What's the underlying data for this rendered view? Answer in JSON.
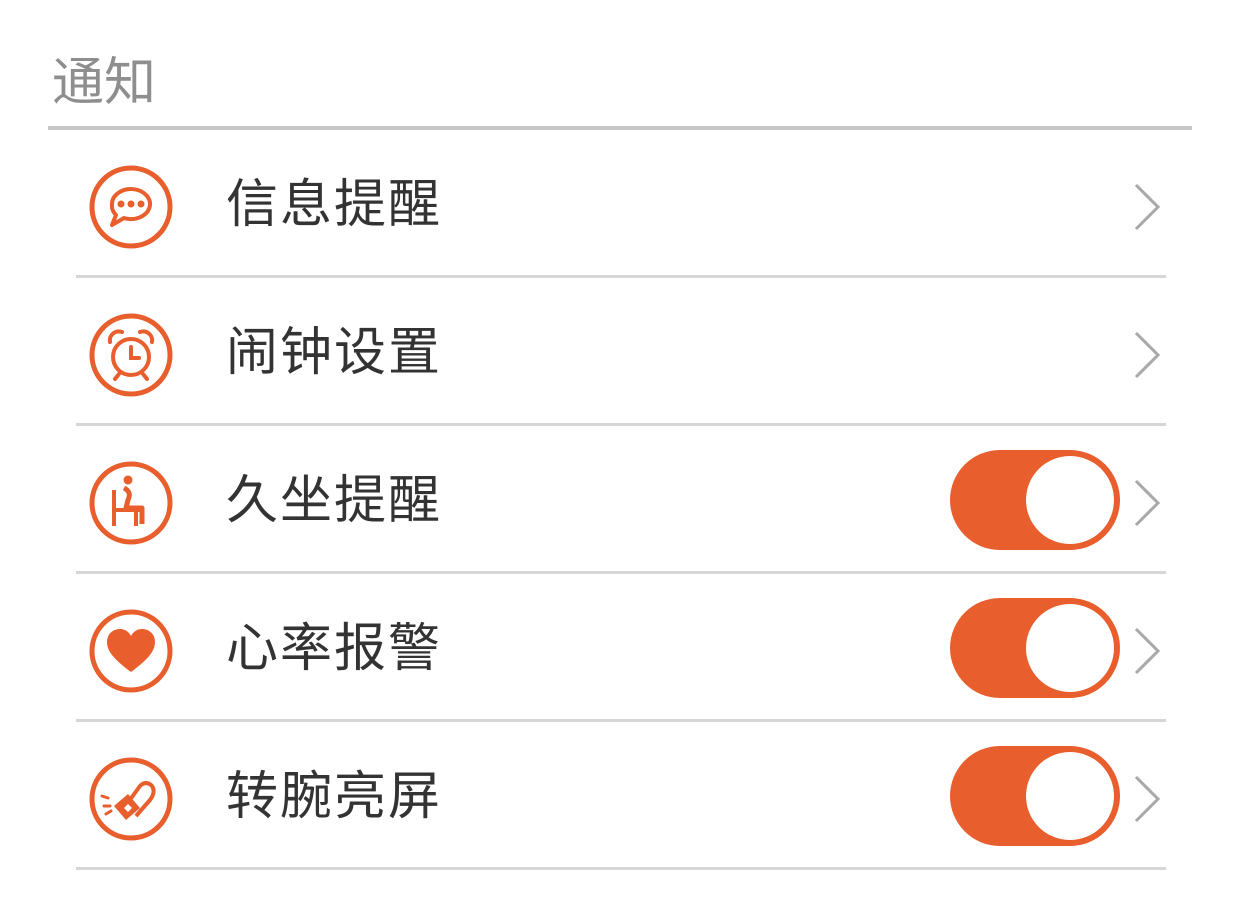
{
  "section": {
    "title": "通知"
  },
  "colors": {
    "accent": "#e85e2c",
    "divider": "#d6d6d6",
    "header_text": "#8e8e8e",
    "label_text": "#333333"
  },
  "items": [
    {
      "label": "信息提醒",
      "icon": "chat-bubble-icon",
      "has_toggle": false,
      "toggle_on": null
    },
    {
      "label": "闹钟设置",
      "icon": "alarm-clock-icon",
      "has_toggle": false,
      "toggle_on": null
    },
    {
      "label": "久坐提醒",
      "icon": "sitting-person-icon",
      "has_toggle": true,
      "toggle_on": true
    },
    {
      "label": "心率报警",
      "icon": "heart-icon",
      "has_toggle": true,
      "toggle_on": true
    },
    {
      "label": "转腕亮屏",
      "icon": "wrist-watch-icon",
      "has_toggle": true,
      "toggle_on": true
    }
  ]
}
